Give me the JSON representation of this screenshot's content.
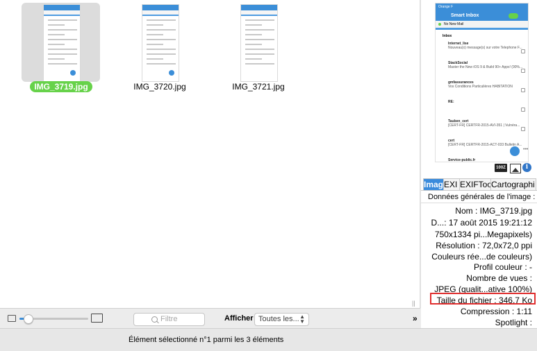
{
  "files": [
    {
      "name": "IMG_3719.jpg",
      "selected": true
    },
    {
      "name": "IMG_3720.jpg",
      "selected": false
    },
    {
      "name": "IMG_3721.jpg",
      "selected": false
    }
  ],
  "toolbar": {
    "filter_placeholder": "Filtre",
    "show_label": "Afficher :",
    "show_value": "Toutes les..."
  },
  "status": {
    "text": "Élément sélectionné n°1 parmi les 3 éléments"
  },
  "preview": {
    "carrier": "Orange F",
    "header": "Smart Inbox",
    "no_new_mail": "No New Mail",
    "inbox": "Inbox",
    "mails": [
      {
        "sender": "Internet_lise",
        "subject": "Nouveau(x) message(s) sur votre Telephone F..."
      },
      {
        "sender": "StackSocial",
        "subject": "Master the New iOS 9 & Build 90+ Apps! (90%..."
      },
      {
        "sender": "gmfassurances",
        "subject": "Vos Conditions Particulières HABITATION"
      },
      {
        "sender": "RE:",
        "subject": ""
      },
      {
        "sender": "Tauben_cert",
        "subject": "[CERT-FR] CERTFR-2015-AVI-351 | Vulnéra..."
      },
      {
        "sender": "cert",
        "subject": "[CERT-FR] CERTFR-2015-ACT-033 Bulletin A..."
      },
      {
        "sender": "Service-public.fr",
        "subject": ""
      }
    ],
    "badge": "100Z"
  },
  "inspector": {
    "tabs": [
      "Imag",
      "EXI",
      "EXIFToo",
      "Cartographi"
    ],
    "title": "Données générales de l'image :",
    "rows": [
      "Nom :  IMG_3719.jpg",
      "D...:  17 août 2015 19:21:12",
      "750x1334 pi...Megapixels)",
      "Résolution :  72,0x72,0 ppi",
      "Couleurs rée...de couleurs)",
      "Profil couleur :  -",
      "Nombre de vues :",
      "JPEG (qualit...ative 100%)",
      "Taille du fichier :  346,7 Ko",
      "Compression :  1:11",
      "Spotlight :"
    ]
  },
  "colors": {
    "accent": "#3a8bdc",
    "selected_label": "#67d24a",
    "highlight_box": "#e02e2e"
  }
}
